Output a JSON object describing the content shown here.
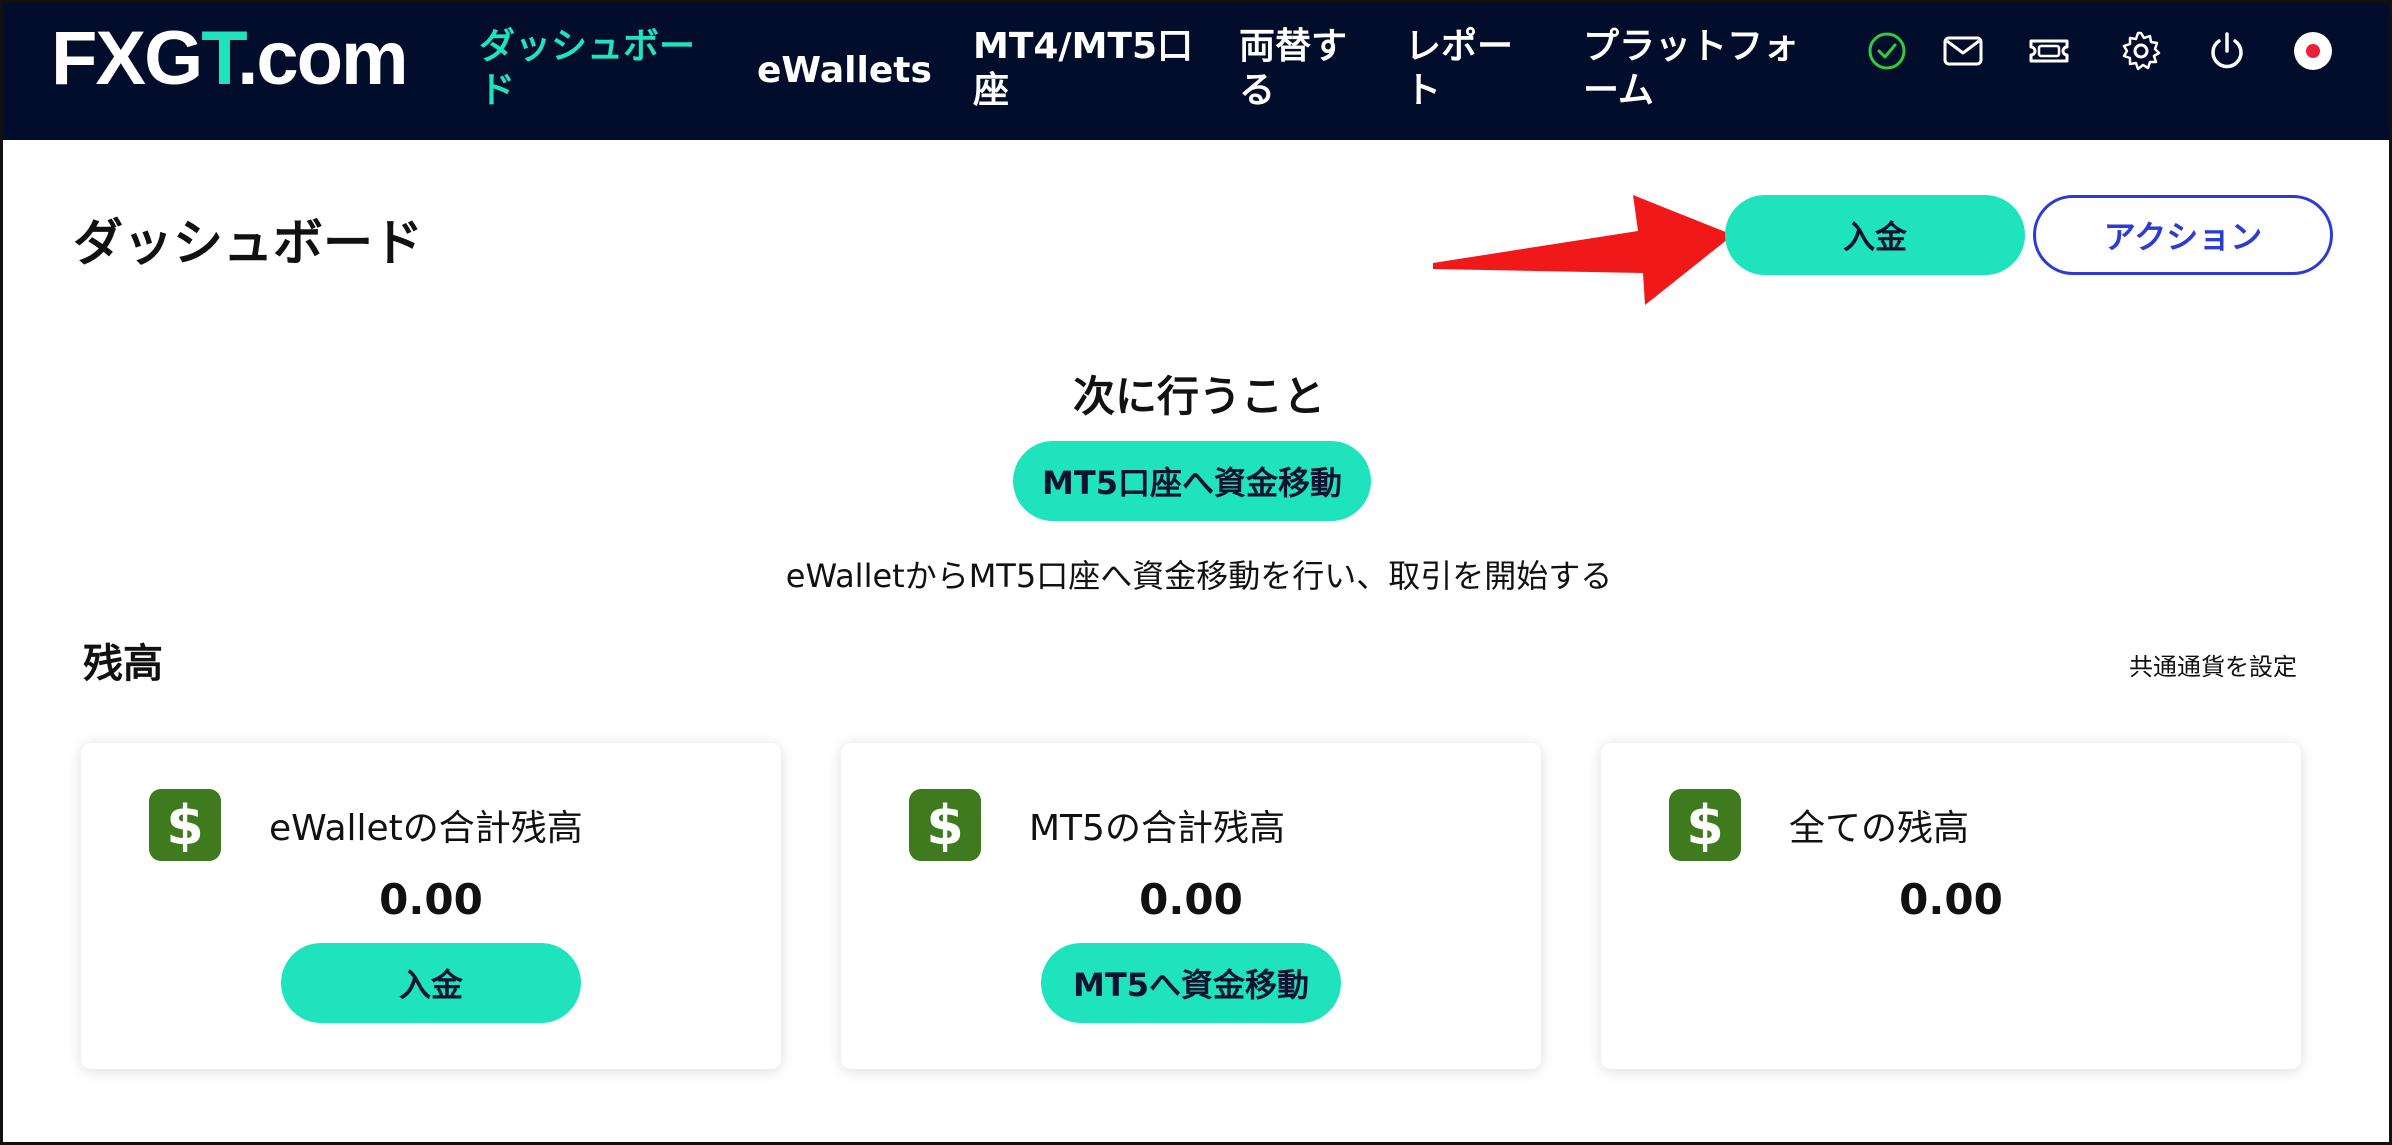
{
  "nav": {
    "logo_main": "FXG",
    "logo_accent": "T",
    "logo_suffix": ".com",
    "items": [
      {
        "line1": "ダッシュボー",
        "line2": "ド"
      },
      {
        "line1": "eWallets",
        "line2": ""
      },
      {
        "line1": "MT4/MT5口",
        "line2": "座"
      },
      {
        "line1": "両替す",
        "line2": "る"
      },
      {
        "line1": "レポー",
        "line2": "ト"
      },
      {
        "line1": "プラットフォ",
        "line2": "ーム"
      }
    ],
    "icons": [
      "check-circle-icon",
      "mail-icon",
      "ticket-icon",
      "gear-icon",
      "power-icon",
      "flag-icon"
    ],
    "accent_color": "#1ee3bd",
    "bg_color": "#020c2b"
  },
  "header": {
    "title": "ダッシュボード",
    "deposit_label": "入金",
    "action_label": "アクション"
  },
  "next_steps": {
    "title": "次に行うこと",
    "button_label": "MT5口座へ資金移動",
    "description": "eWalletからMT5口座へ資金移動を行い、取引を開始する"
  },
  "balance": {
    "title": "残高",
    "currency_link": "共通通貨を設定",
    "cards": [
      {
        "label": "eWalletの合計残高",
        "amount": "0.00",
        "button": "入金"
      },
      {
        "label": "MT5の合計残高",
        "amount": "0.00",
        "button": "MT5へ資金移動"
      },
      {
        "label": "全ての残高",
        "amount": "0.00",
        "button": ""
      }
    ],
    "icon_symbol": "$",
    "icon_color": "#3f7a1f"
  },
  "colors": {
    "primary": "#1ee3bd",
    "outline": "#2a3bd6",
    "annotation_arrow": "#f01818"
  }
}
